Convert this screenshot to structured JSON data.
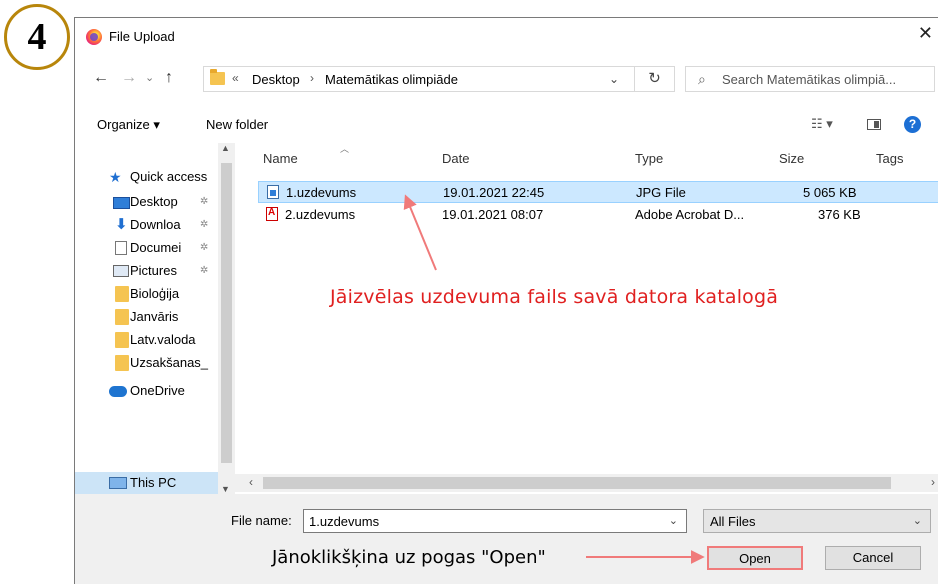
{
  "step_badge": "4",
  "window": {
    "title": "File Upload",
    "close_label": "✕"
  },
  "nav": {
    "back": "←",
    "forward": "→",
    "recent": "⌄",
    "up": "↑",
    "address_chevron": "«",
    "breadcrumbs": [
      "Desktop",
      "Matemātikas olimpiāde"
    ],
    "separator": "›",
    "dropdown": "⌄",
    "refresh": "↻",
    "search_placeholder": "Search Matemātikas olimpiā..."
  },
  "toolbar": {
    "organize": "Organize ▾",
    "new_folder": "New folder",
    "view": "☷ ▾",
    "help": "?"
  },
  "sidebar": {
    "items": [
      {
        "label": "Quick access",
        "icon": "star-icon"
      },
      {
        "label": "Desktop",
        "icon": "desktop-icon",
        "pinned": true
      },
      {
        "label": "Downloa",
        "icon": "download-icon",
        "pinned": true
      },
      {
        "label": "Documei",
        "icon": "document-icon",
        "pinned": true
      },
      {
        "label": "Pictures",
        "icon": "pictures-icon",
        "pinned": true
      },
      {
        "label": "Bioloģija",
        "icon": "folder-icon"
      },
      {
        "label": "Janvāris",
        "icon": "folder-icon"
      },
      {
        "label": "Latv.valoda",
        "icon": "folder-icon"
      },
      {
        "label": "Uzsakšanas_",
        "icon": "folder-icon"
      },
      {
        "label": "OneDrive",
        "icon": "cloud-icon"
      },
      {
        "label": "This PC",
        "icon": "pc-icon"
      }
    ],
    "pin_glyph": "✲"
  },
  "list": {
    "columns": [
      "Name",
      "Date",
      "Type",
      "Size",
      "Tags"
    ],
    "rows": [
      {
        "name": "1.uzdevums",
        "date": "19.01.2021 22:45",
        "type": "JPG File",
        "size": "5 065 KB",
        "selected": true
      },
      {
        "name": "2.uzdevums",
        "date": "19.01.2021 08:07",
        "type": "Adobe Acrobat D...",
        "size": "376 KB",
        "selected": false
      }
    ]
  },
  "bottom": {
    "file_name_label": "File name:",
    "file_name_value": "1.uzdevums",
    "filter_value": "All Files",
    "open_label": "Open",
    "cancel_label": "Cancel"
  },
  "annotations": {
    "select_hint": "Jāizvēlas uzdevuma fails savā datora katalogā",
    "open_hint": "Jānoklikšķina uz pogas \"Open\"",
    "color": "#e02020"
  }
}
